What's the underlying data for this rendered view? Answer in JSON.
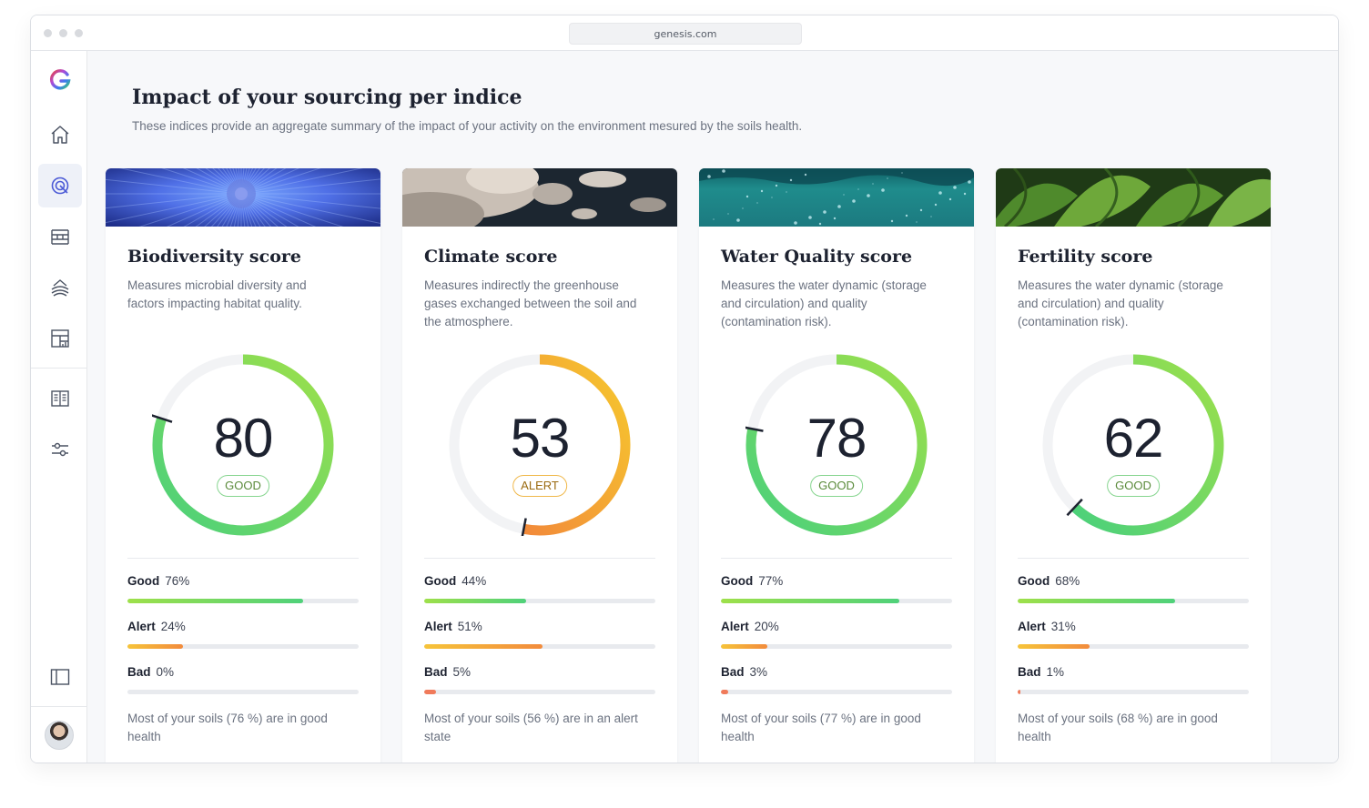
{
  "browser": {
    "url": "genesis.com"
  },
  "sidebar": {
    "logo": "G",
    "items": [
      {
        "name": "home",
        "icon": "home-icon"
      },
      {
        "name": "impact",
        "icon": "target-icon",
        "active": true
      },
      {
        "name": "layers",
        "icon": "layers-icon"
      },
      {
        "name": "fields",
        "icon": "field-icon"
      },
      {
        "name": "reports",
        "icon": "dashboard-icon"
      },
      {
        "name": "docs",
        "icon": "book-icon"
      },
      {
        "name": "settings",
        "icon": "sliders-icon"
      },
      {
        "name": "toggle-panel",
        "icon": "panel-icon"
      }
    ]
  },
  "page": {
    "title": "Impact of your sourcing per indice",
    "subtitle": "These indices provide an aggregate summary of the impact of your activity on the environment mesured by the soils health."
  },
  "labels": {
    "good": "Good",
    "alert": "Alert",
    "bad": "Bad"
  },
  "cards": [
    {
      "title": "Biodiversity score",
      "description": "Measures microbial diversity and factors impacting habitat quality.",
      "score": "80",
      "score_value": 80,
      "status": "GOOD",
      "status_type": "good",
      "good_pct": "76%",
      "good_value": 76,
      "alert_pct": "24%",
      "alert_value": 24,
      "bad_pct": "0%",
      "bad_value": 0,
      "summary": "Most of your soils (76 %) are in good health",
      "banner": "biodiversity"
    },
    {
      "title": "Climate score",
      "description": "Measures indirectly the greenhouse gases exchanged between the soil and the atmosphere.",
      "score": "53",
      "score_value": 53,
      "status": "ALERT",
      "status_type": "alert",
      "good_pct": "44%",
      "good_value": 44,
      "alert_pct": "51%",
      "alert_value": 51,
      "bad_pct": "5%",
      "bad_value": 5,
      "summary": "Most of your soils (56 %) are in an alert state",
      "banner": "climate"
    },
    {
      "title": "Water Quality score",
      "description": "Measures the water dynamic (storage and circulation) and quality (contamination risk).",
      "score": "78",
      "score_value": 78,
      "status": "GOOD",
      "status_type": "good",
      "good_pct": "77%",
      "good_value": 77,
      "alert_pct": "20%",
      "alert_value": 20,
      "bad_pct": "3%",
      "bad_value": 3,
      "summary": "Most of your soils  (77 %) are in good health",
      "banner": "water"
    },
    {
      "title": "Fertility score",
      "description": "Measures the water dynamic (storage and circulation) and quality (contamination risk).",
      "score": "62",
      "score_value": 62,
      "status": "GOOD",
      "status_type": "good",
      "good_pct": "68%",
      "good_value": 68,
      "alert_pct": "31%",
      "alert_value": 31,
      "bad_pct": "1%",
      "bad_value": 1,
      "summary": "Most of your soils (68 %) are in good health",
      "banner": "fertility"
    }
  ]
}
